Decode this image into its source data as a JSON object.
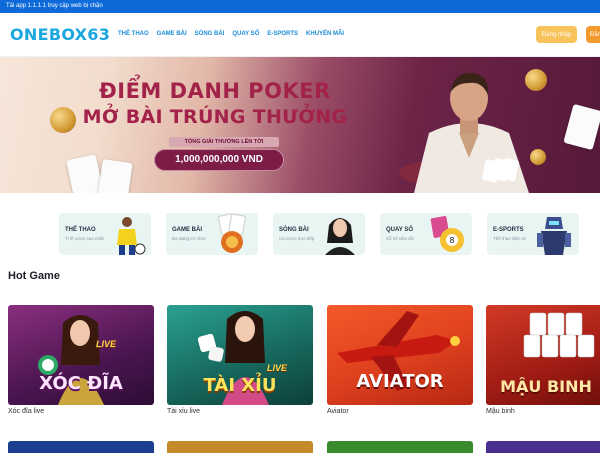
{
  "topbar": {
    "text": "Tải app 1.1.1.1 truy cập web bị chặn"
  },
  "header": {
    "logo": "ONEBOX63",
    "nav": [
      "THỂ THAO",
      "GAME BÀI",
      "SÒNG BÀI",
      "QUAY SỐ",
      "E-SPORTS",
      "KHUYẾN MÃI"
    ],
    "login_label": "Đăng nhập",
    "register_label": "Đăng ký"
  },
  "banner": {
    "title_line1": "ĐIỂM DANH POKER",
    "title_line2": "MỞ BÀI TRÚNG THƯỞNG",
    "prize_label": "TỔNG GIẢI THƯỞNG LÊN TỚI",
    "prize_value": "1,000,000,000 VND",
    "slide_count": 5,
    "active_slide": 1
  },
  "categories": [
    {
      "title": "THỂ THAO",
      "subtitle": "Tỉ lệ cược cao nhất"
    },
    {
      "title": "GAME BÀI",
      "subtitle": "Đa dạng trò chơi"
    },
    {
      "title": "SÒNG BÀI",
      "subtitle": "Ca cược trực tiếp"
    },
    {
      "title": "QUAY SỐ",
      "subtitle": "Xổ số siêu tốc"
    },
    {
      "title": "E-SPORTS",
      "subtitle": "Thể thao điện tử"
    }
  ],
  "hot_games": {
    "title": "Hot Game",
    "items": [
      {
        "name": "Xóc đĩa live",
        "art_title": "XÓC ĐĨA",
        "tag": "LIVE",
        "color": "#5b1f6e"
      },
      {
        "name": "Tài xỉu live",
        "art_title": "TÀI XỈU",
        "tag": "LIVE",
        "color": "#1d7f70"
      },
      {
        "name": "Aviator",
        "art_title": "AVIATOR",
        "tag": "",
        "color": "#e0421f"
      },
      {
        "name": "Mậu binh",
        "art_title": "MẬU BINH",
        "tag": "",
        "color": "#b8261c"
      }
    ]
  },
  "colors": {
    "brand": "#1aa7e0",
    "topbar": "#0d6ad8",
    "login": "#f7c35a",
    "register": "#f29a2e"
  }
}
